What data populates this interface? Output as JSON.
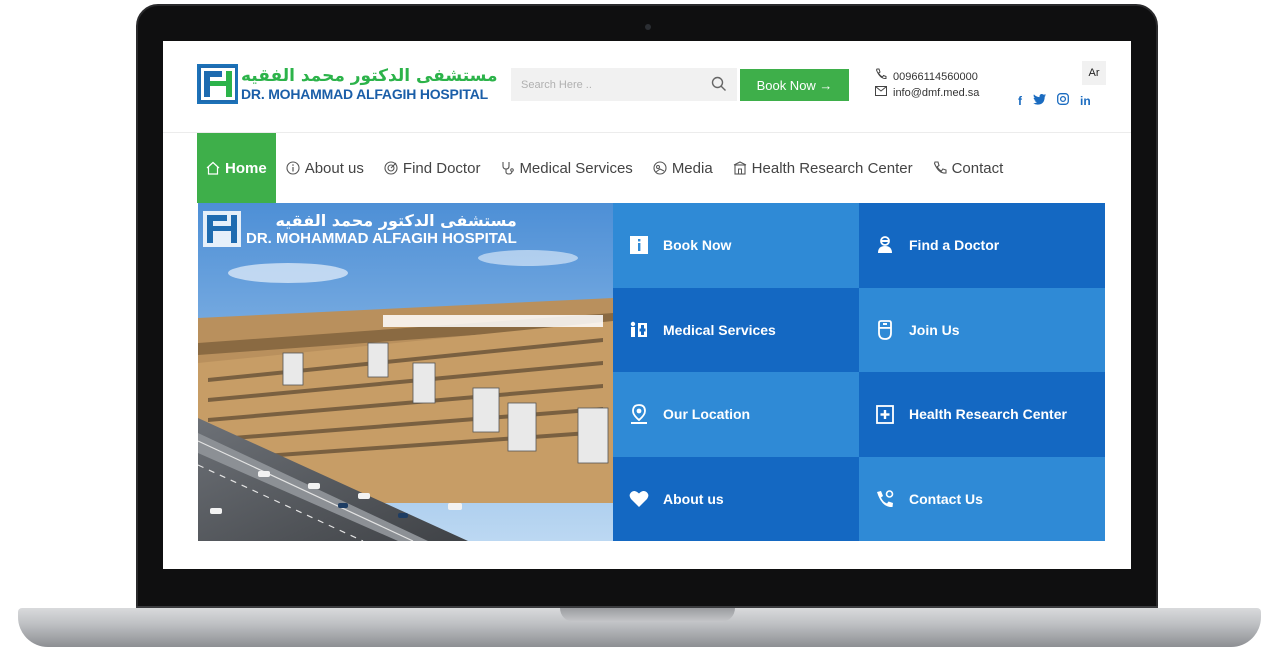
{
  "header": {
    "logo": {
      "arabic": "مستشفى الدكتور محمد الفقيه",
      "english": "DR. MOHAMMAD ALFAGIH HOSPITAL"
    },
    "search": {
      "placeholder": "Search Here .."
    },
    "book_now": "Book Now →",
    "phone": "00966114560000",
    "email": "info@dmf.med.sa",
    "language": "Ar",
    "socials": [
      {
        "icon": "facebook-icon",
        "label": "f"
      },
      {
        "icon": "twitter-icon",
        "label": "t"
      },
      {
        "icon": "instagram-icon",
        "label": "ig"
      },
      {
        "icon": "linkedin-icon",
        "label": "in"
      }
    ]
  },
  "nav": {
    "items": [
      {
        "label": "Home",
        "icon": "home-icon",
        "active": true
      },
      {
        "label": "About us",
        "icon": "info-icon"
      },
      {
        "label": "Find Doctor",
        "icon": "target-icon"
      },
      {
        "label": "Medical Services",
        "icon": "stethoscope-icon"
      },
      {
        "label": "Media",
        "icon": "media-icon"
      },
      {
        "label": "Health Research Center",
        "icon": "building-icon"
      },
      {
        "label": "Contact",
        "icon": "phone-icon"
      }
    ]
  },
  "hero": {
    "image_logo": {
      "arabic": "مستشفى الدكتور محمد الفقيه",
      "english": "DR. MOHAMMAD ALFAGIH HOSPITAL"
    },
    "tiles": [
      {
        "label": "Book Now",
        "icon": "info-box-icon"
      },
      {
        "label": "Find a Doctor",
        "icon": "doctor-icon"
      },
      {
        "label": "Medical Services",
        "icon": "family-icon"
      },
      {
        "label": "Join Us",
        "icon": "badge-icon"
      },
      {
        "label": "Our Location",
        "icon": "location-pin-icon"
      },
      {
        "label": "Health Research Center",
        "icon": "medical-kit-icon"
      },
      {
        "label": "About us",
        "icon": "heart-icon"
      },
      {
        "label": "Contact Us",
        "icon": "phone-call-icon"
      }
    ]
  },
  "colors": {
    "green": "#3eaf4a",
    "blue_dark": "#1468c2",
    "blue_light": "#2f8ad6",
    "logo_blue": "#1a5ea8"
  }
}
